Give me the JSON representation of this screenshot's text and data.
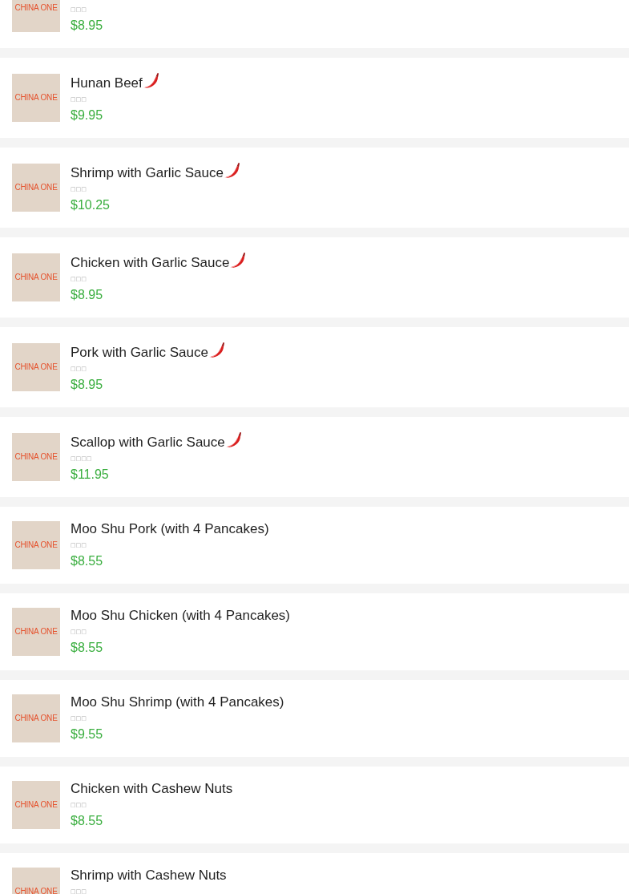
{
  "menu_items": [
    {
      "thumbnail_label": "CHINA ONE",
      "subtitle": "□□□",
      "price": "$8.95"
    },
    {
      "thumbnail_label": "CHINA ONE",
      "name": "Hunan Beef",
      "spicy": true,
      "subtitle": "□□□",
      "price": "$9.95"
    },
    {
      "thumbnail_label": "CHINA ONE",
      "name": "Shrimp with Garlic Sauce",
      "spicy": true,
      "subtitle": "□□□",
      "price": "$10.25"
    },
    {
      "thumbnail_label": "CHINA ONE",
      "name": "Chicken with Garlic Sauce",
      "spicy": true,
      "subtitle": "□□□",
      "price": "$8.95"
    },
    {
      "thumbnail_label": "CHINA ONE",
      "name": "Pork with Garlic Sauce",
      "spicy": true,
      "subtitle": "□□□",
      "price": "$8.95"
    },
    {
      "thumbnail_label": "CHINA ONE",
      "name": "Scallop with Garlic Sauce",
      "spicy": true,
      "subtitle": "□□□□",
      "price": "$11.95"
    },
    {
      "thumbnail_label": "CHINA ONE",
      "name": "Moo Shu Pork (with 4 Pancakes)",
      "spicy": false,
      "subtitle": "□□□",
      "price": "$8.55"
    },
    {
      "thumbnail_label": "CHINA ONE",
      "name": "Moo Shu Chicken (with 4 Pancakes)",
      "spicy": false,
      "subtitle": "□□□",
      "price": "$8.55"
    },
    {
      "thumbnail_label": "CHINA ONE",
      "name": "Moo Shu Shrimp (with 4 Pancakes)",
      "spicy": false,
      "subtitle": "□□□",
      "price": "$9.55"
    },
    {
      "thumbnail_label": "CHINA ONE",
      "name": "Chicken with Cashew Nuts",
      "spicy": false,
      "subtitle": "□□□",
      "price": "$8.55"
    },
    {
      "thumbnail_label": "CHINA ONE",
      "name": "Shrimp with Cashew Nuts",
      "spicy": false,
      "subtitle": "□□□"
    }
  ]
}
